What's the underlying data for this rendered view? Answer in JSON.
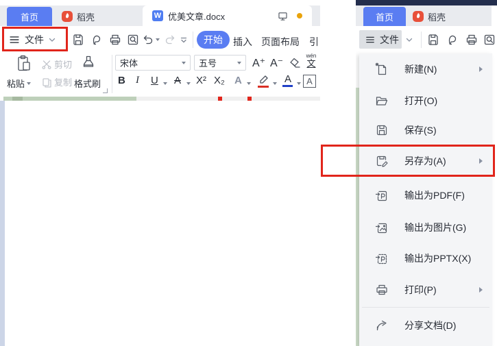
{
  "left": {
    "tab_home": "首页",
    "tab_docer": "稻壳",
    "doc_icon_letter": "W",
    "doc_tab_title": "优美文章.docx",
    "file_menu_label": "文件",
    "ribbon_tabs": {
      "start": "开始",
      "insert": "插入",
      "page_layout": "页面布局",
      "reference_partial": "引"
    },
    "clipboard_group": {
      "paste": "粘贴",
      "cut": "剪切",
      "copy": "复制",
      "format_painter": "格式刷"
    },
    "font_group": {
      "font_family": "宋体",
      "font_size": "五号",
      "grow_font": "A⁺",
      "shrink_font": "A⁻",
      "pinyin_top": "wén",
      "pinyin_bottom": "文",
      "bold": "B",
      "italic": "I",
      "underline": "U",
      "strike_letter": "A",
      "superscript": "X²",
      "subscript": "X₂",
      "text_effect_letter": "A",
      "font_color_letter": "A",
      "char_border_letter": "A"
    }
  },
  "right": {
    "tab_home": "首页",
    "tab_docer": "稻壳",
    "file_menu_label": "文件",
    "pdf_letter": "P",
    "pptx_letter": "P",
    "menu_items": [
      {
        "label": "新建(N)"
      },
      {
        "label": "打开(O)"
      },
      {
        "label": "保存(S)"
      },
      {
        "label": "另存为(A)"
      },
      {
        "label": "输出为PDF(F)"
      },
      {
        "label": "输出为图片(G)"
      },
      {
        "label": "输出为PPTX(X)"
      },
      {
        "label": "打印(P)"
      },
      {
        "label": "分享文档(D)"
      }
    ]
  },
  "colors": {
    "accent_blue": "#5a7df2",
    "annotation_red": "#e1251b",
    "navy_top": "#232e4d",
    "unsaved_dot": "#e9a30b",
    "docer_brand": "#e8503a"
  }
}
